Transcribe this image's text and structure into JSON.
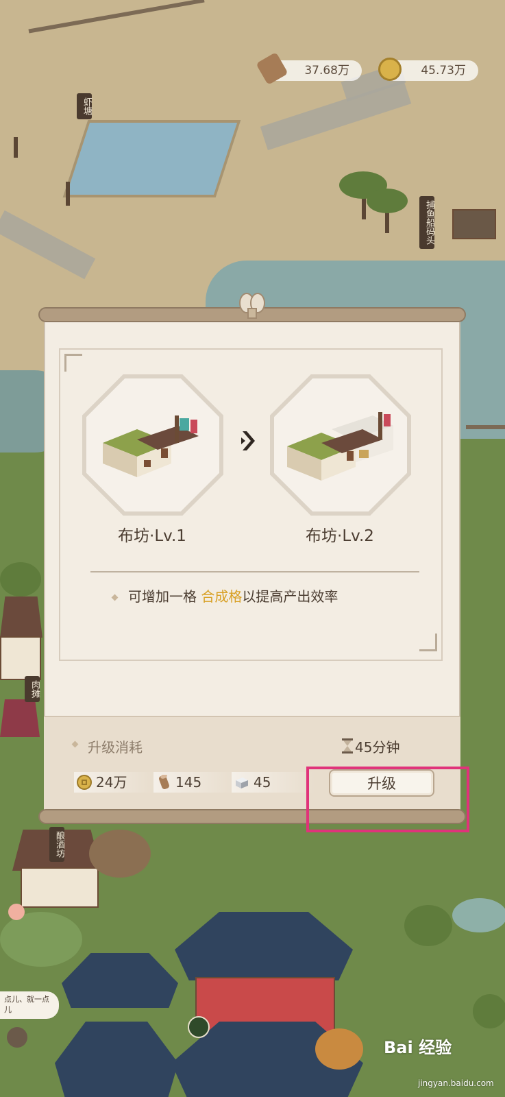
{
  "resources": {
    "wood": "37.68万",
    "coins": "45.73万"
  },
  "map_signs": {
    "shrimp_pond": "虾塘",
    "fishing_dock": "捕鱼船码头",
    "meat_stall": "肉摊",
    "brewery": "酿酒坊"
  },
  "dialog": {
    "current": {
      "label": "布坊·Lv.1"
    },
    "next": {
      "label": "布坊·Lv.2"
    },
    "arrow_icon": "chevron-right-icon",
    "description": {
      "prefix": "可增加一格 ",
      "highlight": "合成格",
      "suffix": "以提高产出效率",
      "highlight_color": "#d8a024"
    },
    "cost": {
      "title": "升级消耗",
      "time": "45分钟",
      "items": [
        {
          "icon": "coin-icon",
          "amount": "24万"
        },
        {
          "icon": "wood-log-icon",
          "amount": "145"
        },
        {
          "icon": "stone-block-icon",
          "amount": "45"
        }
      ]
    },
    "upgrade_button": "升级"
  },
  "chat_bubble": "点儿、就一点儿",
  "watermark": {
    "brand": "Bai  经验",
    "url": "jingyan.baidu.com"
  },
  "colors": {
    "highlight_frame": "#e0337a",
    "paper": "#f3ede3"
  }
}
